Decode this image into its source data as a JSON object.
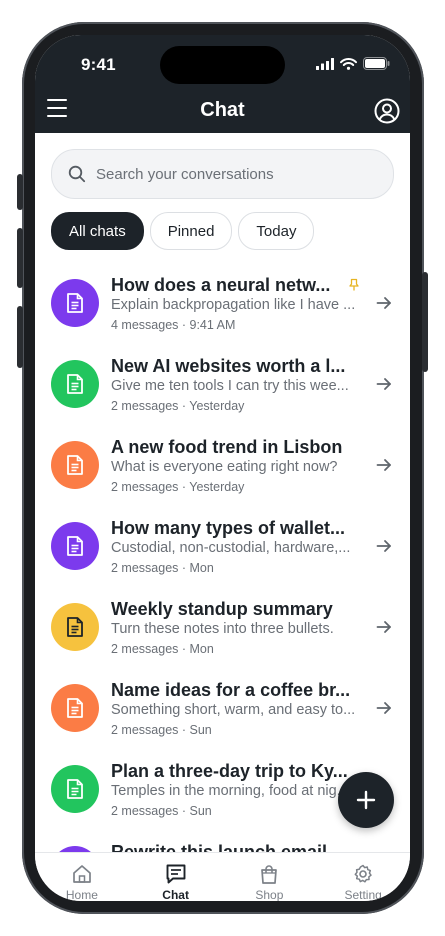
{
  "status_bar": {
    "time": "9:41"
  },
  "header": {
    "title": "Chat"
  },
  "search": {
    "placeholder": "Search your conversations"
  },
  "filters": [
    {
      "label": "All chats",
      "active": true
    },
    {
      "label": "Pinned",
      "active": false
    },
    {
      "label": "Today",
      "active": false
    }
  ],
  "conversations": [
    {
      "title": "How does a neural netw...",
      "subtitle": "Explain backpropagation like I have ...",
      "meta": "4 messages · 9:41 AM",
      "color": "#7c3aed",
      "icon": "document-icon",
      "pinned": true
    },
    {
      "title": "New AI websites worth a l...",
      "subtitle": "Give me ten tools I can try this wee...",
      "meta": "2 messages · Yesterday",
      "color": "#22c55e",
      "icon": "document-icon",
      "pinned": false
    },
    {
      "title": "A new food trend in Lisbon",
      "subtitle": "What is everyone eating right now?",
      "meta": "2 messages · Yesterday",
      "color": "#fb7c45",
      "icon": "document-icon",
      "pinned": false
    },
    {
      "title": "How many types of wallet...",
      "subtitle": "Custodial, non-custodial, hardware,...",
      "meta": "2 messages · Mon",
      "color": "#7c3aed",
      "icon": "document-icon",
      "pinned": false
    },
    {
      "title": "Weekly standup summary",
      "subtitle": "Turn these notes into three bullets.",
      "meta": "2 messages · Mon",
      "color": "#f6c23e",
      "icon": "document-icon",
      "pinned": false
    },
    {
      "title": "Name ideas for a coffee br...",
      "subtitle": "Something short, warm, and easy to...",
      "meta": "2 messages · Sun",
      "color": "#fb7c45",
      "icon": "document-icon",
      "pinned": false
    },
    {
      "title": "Plan a three-day trip to Ky...",
      "subtitle": "Temples in the morning, food at nig...",
      "meta": "2 messages · Sun",
      "color": "#22c55e",
      "icon": "document-icon",
      "pinned": false
    },
    {
      "title": "Rewrite this launch email",
      "subtitle": "",
      "meta": "",
      "color": "#7c3aed",
      "icon": "document-icon",
      "pinned": false
    }
  ],
  "tabs": [
    {
      "label": "Home",
      "icon": "home-icon",
      "active": false
    },
    {
      "label": "Chat",
      "icon": "chat-icon",
      "active": true
    },
    {
      "label": "Shop",
      "icon": "shopping-bag-icon",
      "active": false
    },
    {
      "label": "Setting",
      "icon": "gear-icon",
      "active": false
    }
  ],
  "colors": {
    "dark": "#1d2329",
    "pin": "#e6b422"
  }
}
